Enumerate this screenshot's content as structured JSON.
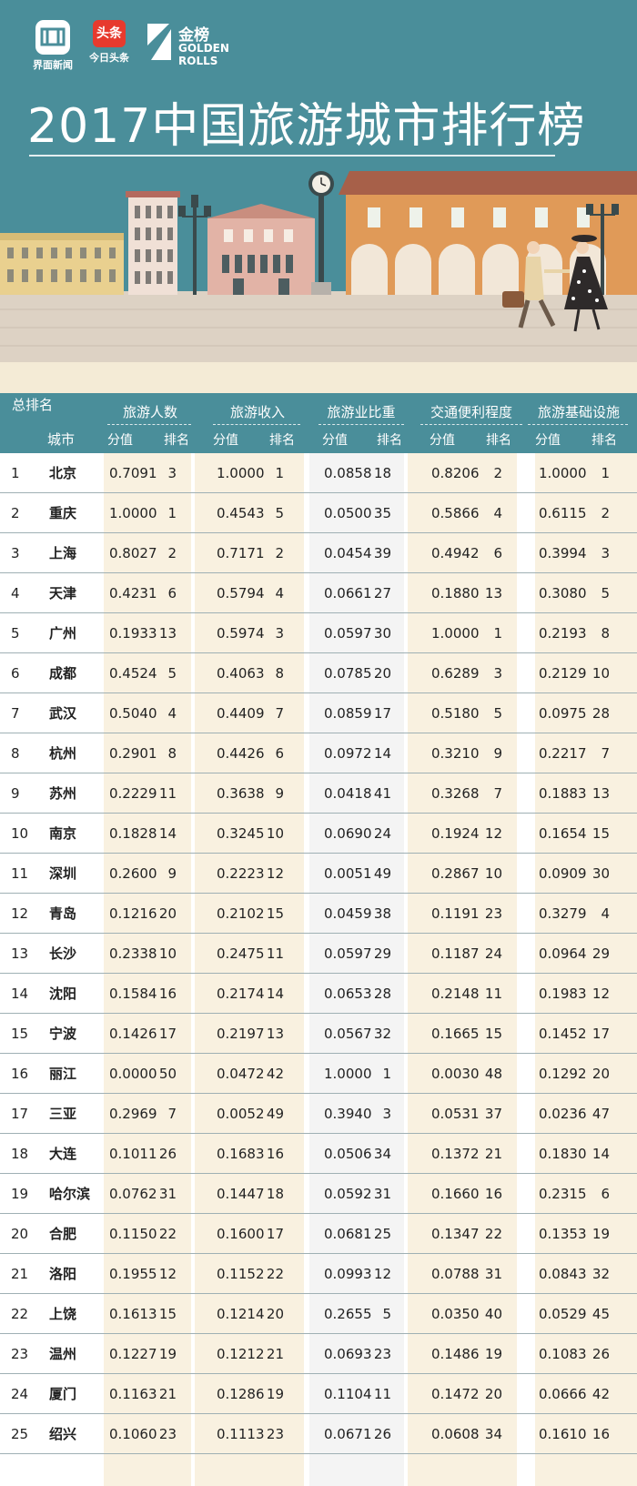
{
  "header": {
    "logos": [
      {
        "name": "界面新闻"
      },
      {
        "name": "今日头条",
        "badge": "头条"
      },
      {
        "name": "金榜",
        "en": [
          "GOLDEN",
          "ROLLS"
        ]
      }
    ],
    "title": "2017中国旅游城市排行榜"
  },
  "colors": {
    "teal": "#4a8e9a",
    "beige": "#f9f1e0",
    "gray": "#f4f4f4",
    "toutiao_red": "#e73a2e"
  },
  "table": {
    "rank_header": "总排名",
    "city_header": "城市",
    "groups": [
      "旅游人数",
      "旅游收入",
      "旅游业比重",
      "交通便利程度",
      "旅游基础设施"
    ],
    "sub_headers": {
      "score": "分值",
      "rank": "排名"
    },
    "rows": [
      {
        "rank": "1",
        "city": "北京",
        "values": [
          [
            "0.7091",
            "3"
          ],
          [
            "1.0000",
            "1"
          ],
          [
            "0.0858",
            "18"
          ],
          [
            "0.8206",
            "2"
          ],
          [
            "1.0000",
            "1"
          ]
        ]
      },
      {
        "rank": "2",
        "city": "重庆",
        "values": [
          [
            "1.0000",
            "1"
          ],
          [
            "0.4543",
            "5"
          ],
          [
            "0.0500",
            "35"
          ],
          [
            "0.5866",
            "4"
          ],
          [
            "0.6115",
            "2"
          ]
        ]
      },
      {
        "rank": "3",
        "city": "上海",
        "values": [
          [
            "0.8027",
            "2"
          ],
          [
            "0.7171",
            "2"
          ],
          [
            "0.0454",
            "39"
          ],
          [
            "0.4942",
            "6"
          ],
          [
            "0.3994",
            "3"
          ]
        ]
      },
      {
        "rank": "4",
        "city": "天津",
        "values": [
          [
            "0.4231",
            "6"
          ],
          [
            "0.5794",
            "4"
          ],
          [
            "0.0661",
            "27"
          ],
          [
            "0.1880",
            "13"
          ],
          [
            "0.3080",
            "5"
          ]
        ]
      },
      {
        "rank": "5",
        "city": "广州",
        "values": [
          [
            "0.1933",
            "13"
          ],
          [
            "0.5974",
            "3"
          ],
          [
            "0.0597",
            "30"
          ],
          [
            "1.0000",
            "1"
          ],
          [
            "0.2193",
            "8"
          ]
        ]
      },
      {
        "rank": "6",
        "city": "成都",
        "values": [
          [
            "0.4524",
            "5"
          ],
          [
            "0.4063",
            "8"
          ],
          [
            "0.0785",
            "20"
          ],
          [
            "0.6289",
            "3"
          ],
          [
            "0.2129",
            "10"
          ]
        ]
      },
      {
        "rank": "7",
        "city": "武汉",
        "values": [
          [
            "0.5040",
            "4"
          ],
          [
            "0.4409",
            "7"
          ],
          [
            "0.0859",
            "17"
          ],
          [
            "0.5180",
            "5"
          ],
          [
            "0.0975",
            "28"
          ]
        ]
      },
      {
        "rank": "8",
        "city": "杭州",
        "values": [
          [
            "0.2901",
            "8"
          ],
          [
            "0.4426",
            "6"
          ],
          [
            "0.0972",
            "14"
          ],
          [
            "0.3210",
            "9"
          ],
          [
            "0.2217",
            "7"
          ]
        ]
      },
      {
        "rank": "9",
        "city": "苏州",
        "values": [
          [
            "0.2229",
            "11"
          ],
          [
            "0.3638",
            "9"
          ],
          [
            "0.0418",
            "41"
          ],
          [
            "0.3268",
            "7"
          ],
          [
            "0.1883",
            "13"
          ]
        ]
      },
      {
        "rank": "10",
        "city": "南京",
        "values": [
          [
            "0.1828",
            "14"
          ],
          [
            "0.3245",
            "10"
          ],
          [
            "0.0690",
            "24"
          ],
          [
            "0.1924",
            "12"
          ],
          [
            "0.1654",
            "15"
          ]
        ]
      },
      {
        "rank": "11",
        "city": "深圳",
        "values": [
          [
            "0.2600",
            "9"
          ],
          [
            "0.2223",
            "12"
          ],
          [
            "0.0051",
            "49"
          ],
          [
            "0.2867",
            "10"
          ],
          [
            "0.0909",
            "30"
          ]
        ]
      },
      {
        "rank": "12",
        "city": "青岛",
        "values": [
          [
            "0.1216",
            "20"
          ],
          [
            "0.2102",
            "15"
          ],
          [
            "0.0459",
            "38"
          ],
          [
            "0.1191",
            "23"
          ],
          [
            "0.3279",
            "4"
          ]
        ]
      },
      {
        "rank": "13",
        "city": "长沙",
        "values": [
          [
            "0.2338",
            "10"
          ],
          [
            "0.2475",
            "11"
          ],
          [
            "0.0597",
            "29"
          ],
          [
            "0.1187",
            "24"
          ],
          [
            "0.0964",
            "29"
          ]
        ]
      },
      {
        "rank": "14",
        "city": "沈阳",
        "values": [
          [
            "0.1584",
            "16"
          ],
          [
            "0.2174",
            "14"
          ],
          [
            "0.0653",
            "28"
          ],
          [
            "0.2148",
            "11"
          ],
          [
            "0.1983",
            "12"
          ]
        ]
      },
      {
        "rank": "15",
        "city": "宁波",
        "values": [
          [
            "0.1426",
            "17"
          ],
          [
            "0.2197",
            "13"
          ],
          [
            "0.0567",
            "32"
          ],
          [
            "0.1665",
            "15"
          ],
          [
            "0.1452",
            "17"
          ]
        ]
      },
      {
        "rank": "16",
        "city": "丽江",
        "values": [
          [
            "0.0000",
            "50"
          ],
          [
            "0.0472",
            "42"
          ],
          [
            "1.0000",
            "1"
          ],
          [
            "0.0030",
            "48"
          ],
          [
            "0.1292",
            "20"
          ]
        ]
      },
      {
        "rank": "17",
        "city": "三亚",
        "values": [
          [
            "0.2969",
            "7"
          ],
          [
            "0.0052",
            "49"
          ],
          [
            "0.3940",
            "3"
          ],
          [
            "0.0531",
            "37"
          ],
          [
            "0.0236",
            "47"
          ]
        ]
      },
      {
        "rank": "18",
        "city": "大连",
        "values": [
          [
            "0.1011",
            "26"
          ],
          [
            "0.1683",
            "16"
          ],
          [
            "0.0506",
            "34"
          ],
          [
            "0.1372",
            "21"
          ],
          [
            "0.1830",
            "14"
          ]
        ]
      },
      {
        "rank": "19",
        "city": "哈尔滨",
        "values": [
          [
            "0.0762",
            "31"
          ],
          [
            "0.1447",
            "18"
          ],
          [
            "0.0592",
            "31"
          ],
          [
            "0.1660",
            "16"
          ],
          [
            "0.2315",
            "6"
          ]
        ]
      },
      {
        "rank": "20",
        "city": "合肥",
        "values": [
          [
            "0.1150",
            "22"
          ],
          [
            "0.1600",
            "17"
          ],
          [
            "0.0681",
            "25"
          ],
          [
            "0.1347",
            "22"
          ],
          [
            "0.1353",
            "19"
          ]
        ]
      },
      {
        "rank": "21",
        "city": "洛阳",
        "values": [
          [
            "0.1955",
            "12"
          ],
          [
            "0.1152",
            "22"
          ],
          [
            "0.0993",
            "12"
          ],
          [
            "0.0788",
            "31"
          ],
          [
            "0.0843",
            "32"
          ]
        ]
      },
      {
        "rank": "22",
        "city": "上饶",
        "values": [
          [
            "0.1613",
            "15"
          ],
          [
            "0.1214",
            "20"
          ],
          [
            "0.2655",
            "5"
          ],
          [
            "0.0350",
            "40"
          ],
          [
            "0.0529",
            "45"
          ]
        ]
      },
      {
        "rank": "23",
        "city": "温州",
        "values": [
          [
            "0.1227",
            "19"
          ],
          [
            "0.1212",
            "21"
          ],
          [
            "0.0693",
            "23"
          ],
          [
            "0.1486",
            "19"
          ],
          [
            "0.1083",
            "26"
          ]
        ]
      },
      {
        "rank": "24",
        "city": "厦门",
        "values": [
          [
            "0.1163",
            "21"
          ],
          [
            "0.1286",
            "19"
          ],
          [
            "0.1104",
            "11"
          ],
          [
            "0.1472",
            "20"
          ],
          [
            "0.0666",
            "42"
          ]
        ]
      },
      {
        "rank": "25",
        "city": "绍兴",
        "values": [
          [
            "0.1060",
            "23"
          ],
          [
            "0.1113",
            "23"
          ],
          [
            "0.0671",
            "26"
          ],
          [
            "0.0608",
            "34"
          ],
          [
            "0.1610",
            "16"
          ]
        ]
      }
    ]
  }
}
